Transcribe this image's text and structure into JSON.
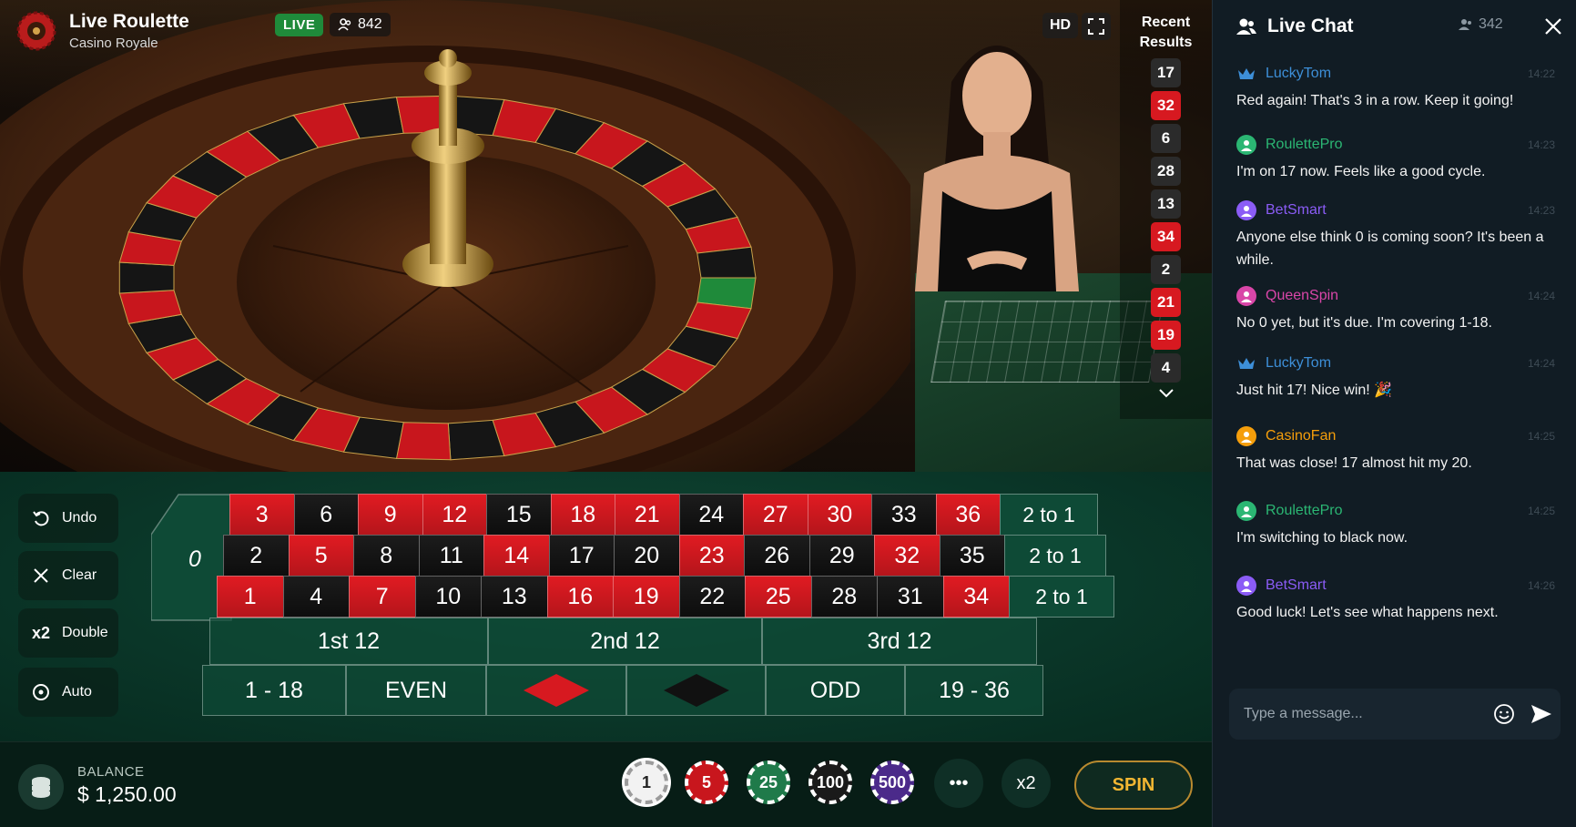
{
  "header": {
    "title": "Live Roulette",
    "subtitle": "Casino Royale",
    "live_label": "LIVE",
    "viewers": "842",
    "hd_label": "HD"
  },
  "recent": {
    "title": "Recent Results",
    "results": [
      {
        "n": "17",
        "color": "black"
      },
      {
        "n": "32",
        "color": "red"
      },
      {
        "n": "6",
        "color": "black"
      },
      {
        "n": "28",
        "color": "black"
      },
      {
        "n": "13",
        "color": "black"
      },
      {
        "n": "34",
        "color": "red"
      },
      {
        "n": "2",
        "color": "black"
      },
      {
        "n": "21",
        "color": "red"
      },
      {
        "n": "19",
        "color": "red"
      },
      {
        "n": "4",
        "color": "black"
      }
    ]
  },
  "controls": {
    "undo": "Undo",
    "clear": "Clear",
    "double_icon": "x2",
    "double": "Double",
    "auto": "Auto"
  },
  "table": {
    "zero": "0",
    "rows": [
      [
        {
          "n": "3",
          "c": "red"
        },
        {
          "n": "6",
          "c": "black"
        },
        {
          "n": "9",
          "c": "red"
        },
        {
          "n": "12",
          "c": "red"
        },
        {
          "n": "15",
          "c": "black"
        },
        {
          "n": "18",
          "c": "red"
        },
        {
          "n": "21",
          "c": "red"
        },
        {
          "n": "24",
          "c": "black"
        },
        {
          "n": "27",
          "c": "red"
        },
        {
          "n": "30",
          "c": "red"
        },
        {
          "n": "33",
          "c": "black"
        },
        {
          "n": "36",
          "c": "red"
        }
      ],
      [
        {
          "n": "2",
          "c": "black"
        },
        {
          "n": "5",
          "c": "red"
        },
        {
          "n": "8",
          "c": "black"
        },
        {
          "n": "11",
          "c": "black"
        },
        {
          "n": "14",
          "c": "red"
        },
        {
          "n": "17",
          "c": "black"
        },
        {
          "n": "20",
          "c": "black"
        },
        {
          "n": "23",
          "c": "red"
        },
        {
          "n": "26",
          "c": "black"
        },
        {
          "n": "29",
          "c": "black"
        },
        {
          "n": "32",
          "c": "red"
        },
        {
          "n": "35",
          "c": "black"
        }
      ],
      [
        {
          "n": "1",
          "c": "red"
        },
        {
          "n": "4",
          "c": "black"
        },
        {
          "n": "7",
          "c": "red"
        },
        {
          "n": "10",
          "c": "black"
        },
        {
          "n": "13",
          "c": "black"
        },
        {
          "n": "16",
          "c": "red"
        },
        {
          "n": "19",
          "c": "red"
        },
        {
          "n": "22",
          "c": "black"
        },
        {
          "n": "25",
          "c": "red"
        },
        {
          "n": "28",
          "c": "black"
        },
        {
          "n": "31",
          "c": "black"
        },
        {
          "n": "34",
          "c": "red"
        }
      ]
    ],
    "columns": [
      "2 to 1",
      "2 to 1",
      "2 to 1"
    ],
    "dozens": [
      "1st 12",
      "2nd 12",
      "3rd 12"
    ],
    "outside": [
      "1 - 18",
      "EVEN",
      "",
      "",
      "ODD",
      "19 - 36"
    ]
  },
  "bottom": {
    "balance_label": "BALANCE",
    "balance_value": "$ 1,250.00",
    "chips": [
      "1",
      "5",
      "25",
      "100",
      "500"
    ],
    "more": "•••",
    "x2": "x2",
    "spin": "SPIN"
  },
  "chat": {
    "title": "Live Chat",
    "count": "342",
    "placeholder": "Type a message...",
    "messages": [
      {
        "user": "LuckyTom",
        "time": "14:22",
        "text": "Red again! That's 3 in a row. Keep it going!",
        "color": "#3d8fd8",
        "icon": "crown-icon"
      },
      {
        "user": "RoulettePro",
        "time": "14:23",
        "text": "I'm on 17 now. Feels like a good cycle.",
        "color": "#2bb673",
        "icon": "user-icon"
      },
      {
        "user": "BetSmart",
        "time": "14:23",
        "text": "Anyone else think 0 is coming soon? It's been a while.",
        "color": "#8b5cf6",
        "icon": "user-icon"
      },
      {
        "user": "QueenSpin",
        "time": "14:24",
        "text": "No 0 yet, but it's due. I'm covering 1-18.",
        "color": "#d946a8",
        "icon": "user-icon"
      },
      {
        "user": "LuckyTom",
        "time": "14:24",
        "text": "Just hit 17! Nice win! 🎉",
        "color": "#3d8fd8",
        "icon": "crown-icon"
      },
      {
        "user": "CasinoFan",
        "time": "14:25",
        "text": "That was close! 17 almost hit my 20.",
        "color": "#f59e0b",
        "icon": "user-icon"
      },
      {
        "user": "RoulettePro",
        "time": "14:25",
        "text": "I'm switching to black now.",
        "color": "#2bb673",
        "icon": "user-icon"
      },
      {
        "user": "BetSmart",
        "time": "14:26",
        "text": "Good luck! Let's see what happens next.",
        "color": "#8b5cf6",
        "icon": "user-icon"
      }
    ]
  }
}
